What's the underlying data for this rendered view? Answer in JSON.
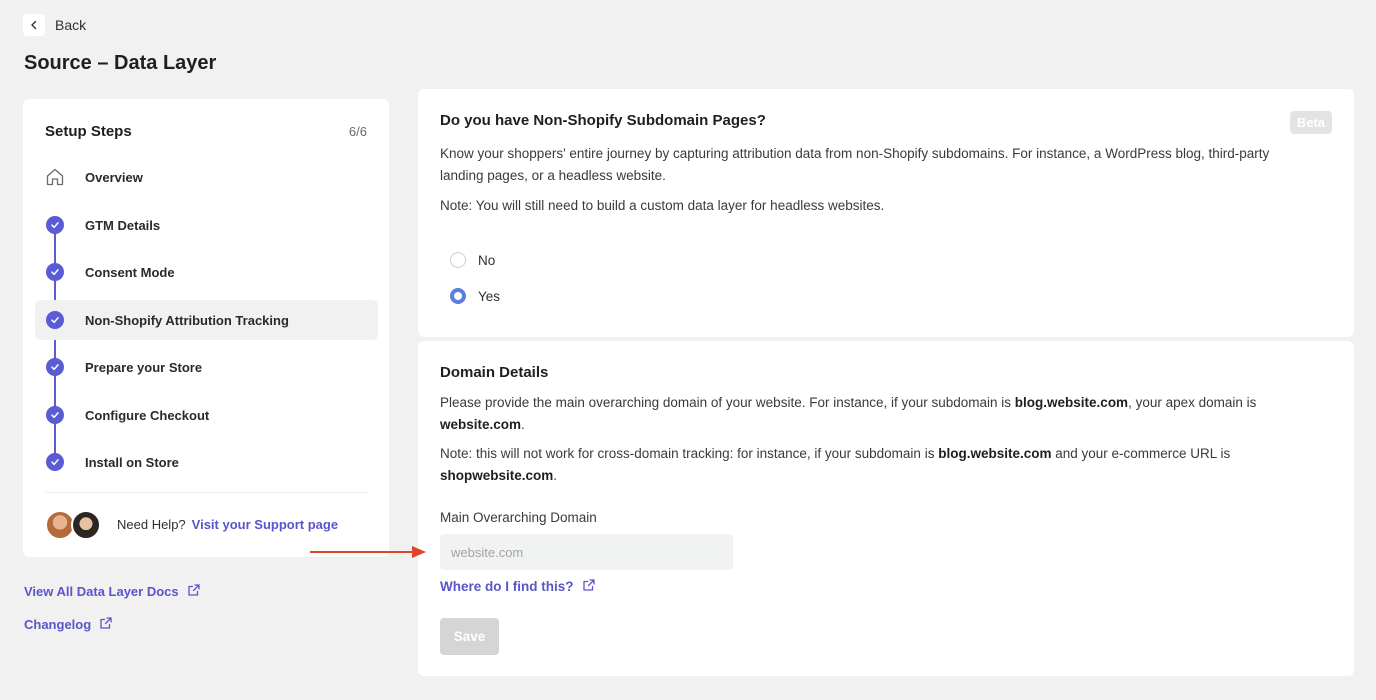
{
  "nav": {
    "back_label": "Back"
  },
  "page": {
    "title": "Source – Data Layer"
  },
  "setup": {
    "title": "Setup Steps",
    "count": "6/6",
    "steps": [
      {
        "label": "Overview",
        "icon": "home-icon"
      },
      {
        "label": "GTM Details",
        "icon": "check-icon"
      },
      {
        "label": "Consent Mode",
        "icon": "check-icon"
      },
      {
        "label": "Non-Shopify Attribution Tracking",
        "icon": "check-icon"
      },
      {
        "label": "Prepare your Store",
        "icon": "check-icon"
      },
      {
        "label": "Configure Checkout",
        "icon": "check-icon"
      },
      {
        "label": "Install on Store",
        "icon": "check-icon"
      }
    ],
    "help_text": "Need Help?",
    "help_link": "Visit your Support page"
  },
  "links": {
    "docs": "View All Data Layer Docs",
    "changelog": "Changelog"
  },
  "subdomain": {
    "title": "Do you have Non-Shopify Subdomain Pages?",
    "badge": "Beta",
    "description": "Know your shoppers' entire journey by capturing attribution data from non-Shopify subdomains. For instance, a WordPress blog, third-party landing pages, or a headless website.",
    "note": "Note: You will still need to build a custom data layer for headless websites.",
    "options": [
      {
        "label": "No",
        "selected": false
      },
      {
        "label": "Yes",
        "selected": true
      }
    ]
  },
  "domain": {
    "title": "Domain Details",
    "desc_prefix": "Please provide the main overarching domain of your website. For instance, if your subdomain is ",
    "desc_sub": "blog.website.com",
    "desc_mid": ", your apex domain is ",
    "desc_apex": "website.com",
    "desc_end": ".",
    "note_prefix": "Note: this will not work for cross-domain tracking: for instance, if your subdomain is ",
    "note_sub": "blog.website.com",
    "note_mid": " and your e-commerce URL is ",
    "note_url": "shopwebsite.com",
    "note_end": ".",
    "field_label": "Main Overarching Domain",
    "field_placeholder": "website.com",
    "field_value": "",
    "find_link": "Where do I find this?",
    "save_label": "Save"
  },
  "colors": {
    "accent": "#5b5bd6",
    "link": "#5a55c9",
    "radio": "#5b7ee0",
    "arrow": "#e0452b"
  }
}
